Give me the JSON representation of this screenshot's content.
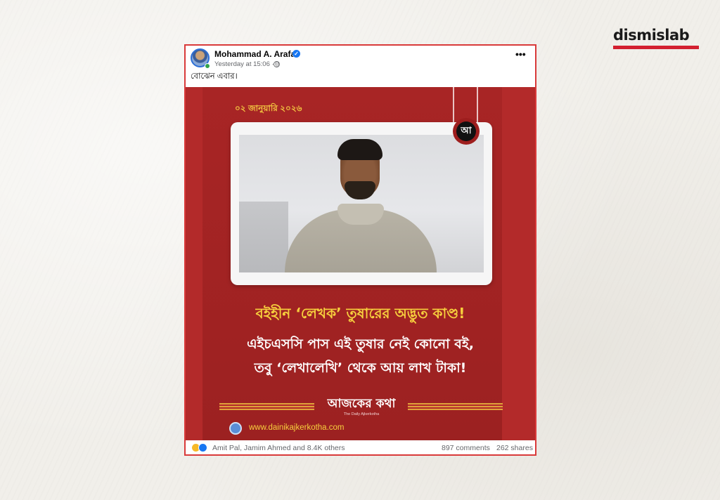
{
  "brand": {
    "name": "dismislab",
    "accent_color": "#d32030"
  },
  "post": {
    "author": "Mohammad A. Arafat",
    "verified": true,
    "timestamp": "Yesterday at 15:06 ·",
    "audience_icon": "globe-icon",
    "more_icon": "•••",
    "text": "বোঝেন এবার।",
    "graphic": {
      "date": "০২ জানুয়ারি ২০২৬",
      "badge_letter": "আ",
      "headline": "বইহীন ‘লেখক’ তুষারের অদ্ভুত কাণ্ড!",
      "subline_1": "এইচএসসি পাস এই তুষার নেই কোনো বই,",
      "subline_2": "তবু ‘লেখালেখি’ থেকে আয় লাখ টাকা!",
      "logo_main": "আজকের কথা",
      "logo_sub": "The Daily Ajkerkotha",
      "website": "www.dainikajkerkotha.com",
      "background_color": "#b32a2a",
      "headline_color": "#f6cf3d"
    },
    "footer": {
      "reactions": [
        "haha",
        "like"
      ],
      "reactors": "Amit Pal, Jamim Ahmed and 8.4K others",
      "comments": "897 comments",
      "shares": "262 shares"
    }
  }
}
